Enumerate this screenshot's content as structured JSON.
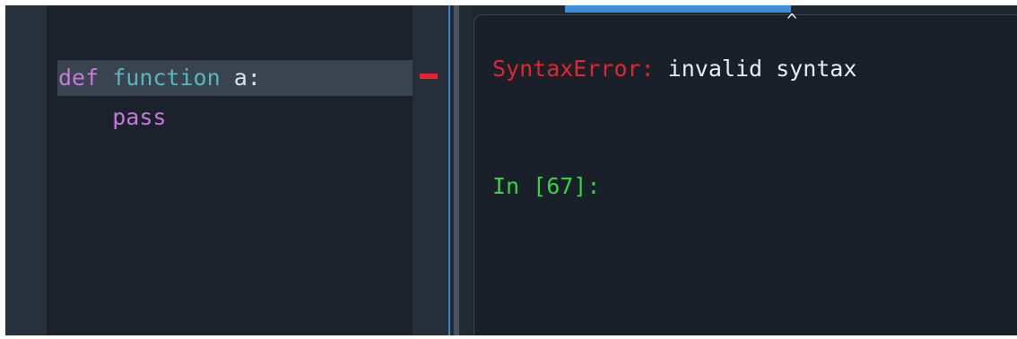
{
  "editor": {
    "line1": {
      "keyword": "def",
      "function_word": "function",
      "rest": "a:"
    },
    "line2": {
      "indent": "    ",
      "statement": "pass"
    },
    "error_marker": "error-line-marker"
  },
  "console": {
    "caret": "^",
    "error": {
      "type": "SyntaxError:",
      "message": "invalid syntax"
    },
    "prompt": {
      "label": "In ",
      "number": "[67]",
      "suffix": ":"
    }
  },
  "colors": {
    "keyword": "#c678dd",
    "function_word": "#56b6c2",
    "error": "#e0262f",
    "prompt": "#34d53e",
    "accent": "#3d8fd8"
  }
}
